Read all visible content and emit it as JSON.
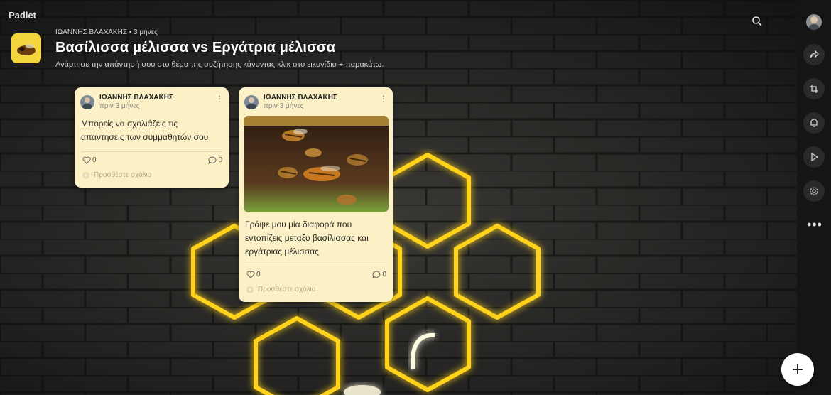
{
  "app": {
    "name": "Padlet"
  },
  "header": {
    "meta": "ΙΩΑΝΝΗΣ ΒΛΑΧΑΚΗΣ • 3 μήνες",
    "title": "Βασίλισσα μέλισσα vs Εργάτρια μέλισσα",
    "description": "Ανάρτησε την απάντησή σου στο θέμα της συζήτησης κάνοντας κλικ στο εικονίδιο + παρακάτω."
  },
  "toolbar": {
    "search_icon": "search-icon"
  },
  "rail": {
    "buttons": [
      "share-icon",
      "remake-icon",
      "bell-icon",
      "play-icon",
      "gear-icon"
    ],
    "more": "•••"
  },
  "posts": [
    {
      "author": "ΙΩΑΝΝΗΣ ΒΛΑΧΑΚΗΣ",
      "time": "πριν 3 μήνες",
      "text": "Μπορείς να σχολιάζεις τις απαντήσεις των συμμαθητών σου",
      "likes": "0",
      "comments": "0",
      "add_comment": "Προσθέστε σχόλιο"
    },
    {
      "author": "ΙΩΑΝΝΗΣ ΒΛΑΧΑΚΗΣ",
      "time": "πριν 3 μήνες",
      "text": "Γράψε μου μία διαφορά που εντοπίζεις μεταξύ βασίλισσας και εργάτριας μέλισσας",
      "likes": "0",
      "comments": "0",
      "add_comment": "Προσθέστε σχόλιο"
    }
  ],
  "colors": {
    "wall": "#2b2a28",
    "neon": "#ffd21a",
    "card": "#fcf1c6",
    "rail": "#151515"
  }
}
